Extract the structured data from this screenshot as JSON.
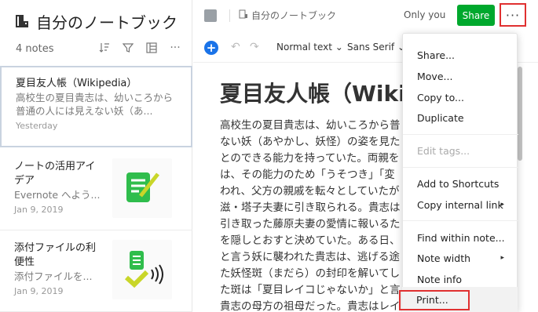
{
  "notelist": {
    "title": "自分のノートブック",
    "count": "4 notes",
    "notes": [
      {
        "title": "夏目友人帳（Wikipedia）",
        "snippet": "高校生の夏目貴志は、幼いころから普通の人には見えない妖（あ...",
        "date": "Yesterday"
      },
      {
        "title": "ノートの活用アイデア",
        "snippet": "Evernote へよう...",
        "date": "Jan 9, 2019"
      },
      {
        "title": "添付ファイルの利便性",
        "snippet": "添付ファイルを...",
        "date": "Jan 9, 2019"
      }
    ]
  },
  "topbar": {
    "breadcrumb": "自分のノートブック",
    "sharing": "Only you",
    "share_label": "Share",
    "more_label": "···"
  },
  "toolbar": {
    "plus": "+",
    "undo": "↶",
    "redo": "↷",
    "format": "Normal text ⌄",
    "font": "Sans Serif ⌄"
  },
  "doc": {
    "title": "夏目友人帳（Wikipe",
    "lines": [
      "高校生の夏目貴志は、幼いころから普",
      "ない妖（あやかし、妖怪）の姿を見た",
      "とのできる能力を持っていた。両親を",
      "は、その能力のため「うそつき」「変",
      "われ、父方の親戚を転々としていたが",
      "滋・塔子夫妻に引き取られる。貴志は",
      "引き取った藤原夫妻の愛情に報いるた",
      "を隠しとおすと決めていた。ある日、",
      "と言う妖に襲われた貴志は、逃げる途",
      "た妖怪斑（まだら）の封印を解いてし",
      "た斑は「夏目レイコじゃないか」と言",
      "貴志の母方の祖母だった。貴志はレイ"
    ]
  },
  "menu": {
    "items": [
      {
        "label": "Share...",
        "arrow": ""
      },
      {
        "label": "Move...",
        "arrow": ""
      },
      {
        "label": "Copy to...",
        "arrow": ""
      },
      {
        "label": "Duplicate",
        "arrow": ""
      },
      {
        "label": "Edit tags...",
        "arrow": "",
        "disabled": true
      },
      {
        "label": "Add to Shortcuts",
        "arrow": ""
      },
      {
        "label": "Copy internal link",
        "arrow": "▸"
      },
      {
        "label": "Find within note...",
        "arrow": ""
      },
      {
        "label": "Note width",
        "arrow": "▸"
      },
      {
        "label": "Note info",
        "arrow": ""
      },
      {
        "label": "Print...",
        "arrow": ""
      }
    ]
  },
  "colors": {
    "accent_green": "#00a82d",
    "highlight_red": "#e03030",
    "link_blue": "#1a5fd4"
  }
}
